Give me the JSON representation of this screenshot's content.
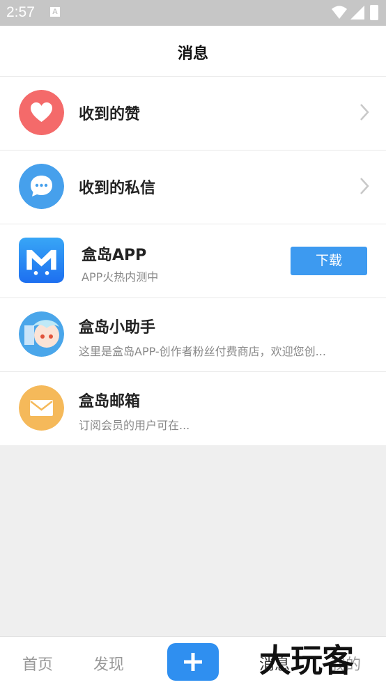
{
  "status_bar": {
    "time": "2:57",
    "notification_letter": "A"
  },
  "header": {
    "title": "消息"
  },
  "items": [
    {
      "title": "收到的赞",
      "subtitle": "",
      "icon": "heart-icon",
      "color": "#f46a6a"
    },
    {
      "title": "收到的私信",
      "subtitle": "",
      "icon": "chat-bubble-icon",
      "color": "#46a0ec"
    },
    {
      "title": "盒岛APP",
      "subtitle": "APP火热内测中",
      "icon": "app-logo-icon",
      "color": "#2b87f3",
      "button": "下载"
    },
    {
      "title": "盒岛小助手",
      "subtitle": "这里是盒岛APP-创作者粉丝付费商店，欢迎您创...",
      "icon": "assistant-avatar",
      "color": "#4aa6ea"
    },
    {
      "title": "盒岛邮箱",
      "subtitle": "订阅会员的用户可在...",
      "icon": "mail-icon",
      "color": "#f5b95a"
    }
  ],
  "bottom_nav": {
    "home": "首页",
    "discover": "发现",
    "messages": "消息",
    "me": "我的"
  },
  "watermark": "大玩客"
}
